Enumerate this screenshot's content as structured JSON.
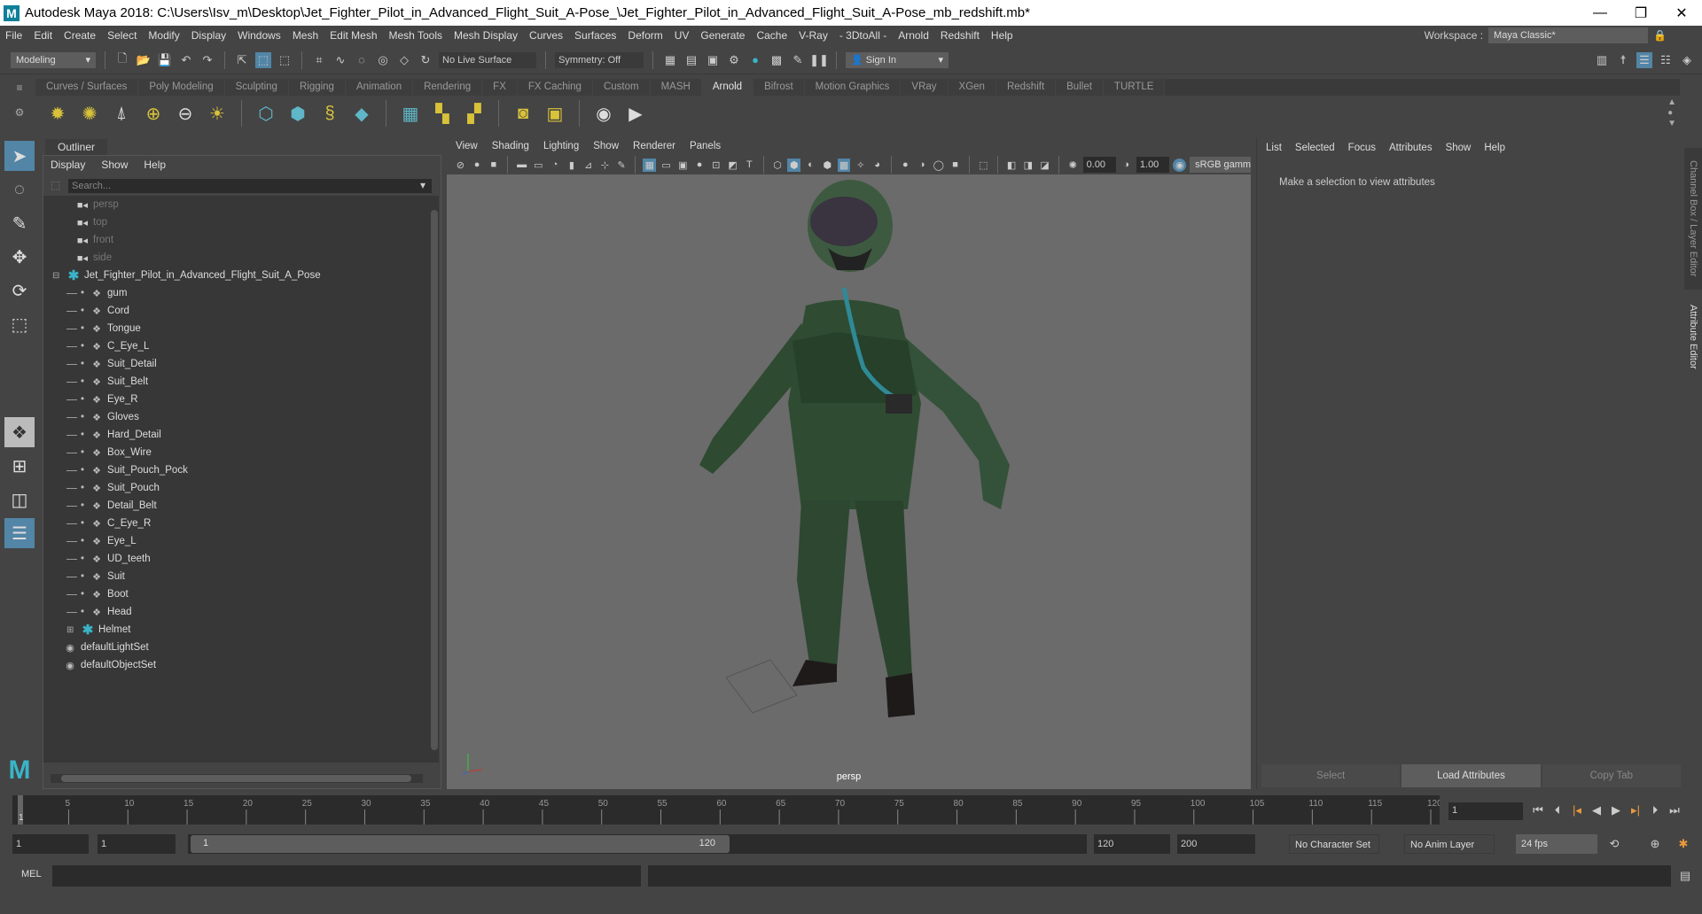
{
  "window": {
    "title": "Autodesk Maya 2018: C:\\Users\\Isv_m\\Desktop\\Jet_Fighter_Pilot_in_Advanced_Flight_Suit_A-Pose_\\Jet_Fighter_Pilot_in_Advanced_Flight_Suit_A-Pose_mb_redshift.mb*",
    "logo": "M"
  },
  "menu": [
    "File",
    "Edit",
    "Create",
    "Select",
    "Modify",
    "Display",
    "Windows",
    "Mesh",
    "Edit Mesh",
    "Mesh Tools",
    "Mesh Display",
    "Curves",
    "Surfaces",
    "Deform",
    "UV",
    "Generate",
    "Cache",
    "V-Ray",
    "- 3DtoAll -",
    "Arnold",
    "Redshift",
    "Help"
  ],
  "workspace": {
    "label": "Workspace :",
    "value": "Maya Classic*"
  },
  "statusline": {
    "mode": "Modeling",
    "live_surface": "No Live Surface",
    "symmetry": "Symmetry: Off",
    "sign_in": "Sign In"
  },
  "shelf_tabs": [
    "Curves / Surfaces",
    "Poly Modeling",
    "Sculpting",
    "Rigging",
    "Animation",
    "Rendering",
    "FX",
    "FX Caching",
    "Custom",
    "MASH",
    "Arnold",
    "Bifrost",
    "Motion Graphics",
    "VRay",
    "XGen",
    "Redshift",
    "Bullet",
    "TURTLE"
  ],
  "shelf_active": "Arnold",
  "outliner": {
    "tab": "Outliner",
    "menu": [
      "Display",
      "Show",
      "Help"
    ],
    "search_placeholder": "Search...",
    "cameras": [
      "persp",
      "top",
      "front",
      "side"
    ],
    "root": "Jet_Fighter_Pilot_in_Advanced_Flight_Suit_A_Pose",
    "children": [
      "gum",
      "Cord",
      "Tongue",
      "C_Eye_L",
      "Suit_Detail",
      "Suit_Belt",
      "Eye_R",
      "Gloves",
      "Hard_Detail",
      "Box_Wire",
      "Suit_Pouch_Pock",
      "Suit_Pouch",
      "Detail_Belt",
      "C_Eye_R",
      "Eye_L",
      "UD_teeth",
      "Suit",
      "Boot",
      "Head"
    ],
    "group_child": "Helmet",
    "sets": [
      "defaultLightSet",
      "defaultObjectSet"
    ]
  },
  "viewport": {
    "menu": [
      "View",
      "Shading",
      "Lighting",
      "Show",
      "Renderer",
      "Panels"
    ],
    "exposure": "0.00",
    "gamma": "1.00",
    "color_space": "sRGB gamm",
    "camera_label": "persp"
  },
  "attribute_editor": {
    "menu": [
      "List",
      "Selected",
      "Focus",
      "Attributes",
      "Show",
      "Help"
    ],
    "message": "Make a selection to view attributes",
    "buttons": [
      "Select",
      "Load Attributes",
      "Copy Tab"
    ]
  },
  "side_tabs": {
    "channel_box": "Channel Box / Layer Editor",
    "attribute_editor": "Attribute Editor"
  },
  "timeline": {
    "start": 1,
    "end": 120,
    "step": 5,
    "current_frame": "1",
    "current_marker": "1"
  },
  "range": {
    "start": "1",
    "playback_start": "1",
    "thumb_start": "1",
    "thumb_end": "120",
    "playback_end": "120",
    "end": "200",
    "character_set": "No Character Set",
    "anim_layer": "No Anim Layer",
    "fps": "24 fps"
  },
  "mel": {
    "label": "MEL"
  },
  "colors": {
    "accent": "#5285a6",
    "panel": "#444444",
    "viewport": "#6b6b6b",
    "teal": "#3ab4c8"
  }
}
